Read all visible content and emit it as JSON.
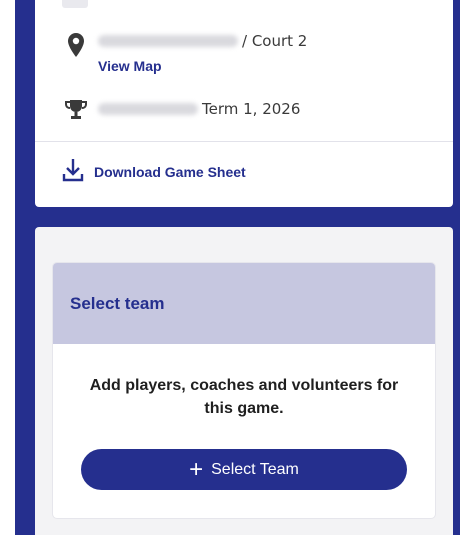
{
  "game": {
    "venue_suffix": "/ Court 2",
    "view_map_label": "View Map",
    "term": "Term 1, 2026",
    "download_label": "Download Game Sheet"
  },
  "team_panel": {
    "title": "Select team",
    "message": "Add players, coaches and volunteers for this game.",
    "button_label": "Select Team",
    "button_icon": "+"
  },
  "icons": {
    "location": "map-pin-icon",
    "competition": "trophy-icon",
    "download": "download-icon",
    "add": "plus-icon"
  },
  "colors": {
    "accent": "#252f8e",
    "panel_header": "#c6c7e0",
    "background_card": "#f3f3f5"
  }
}
